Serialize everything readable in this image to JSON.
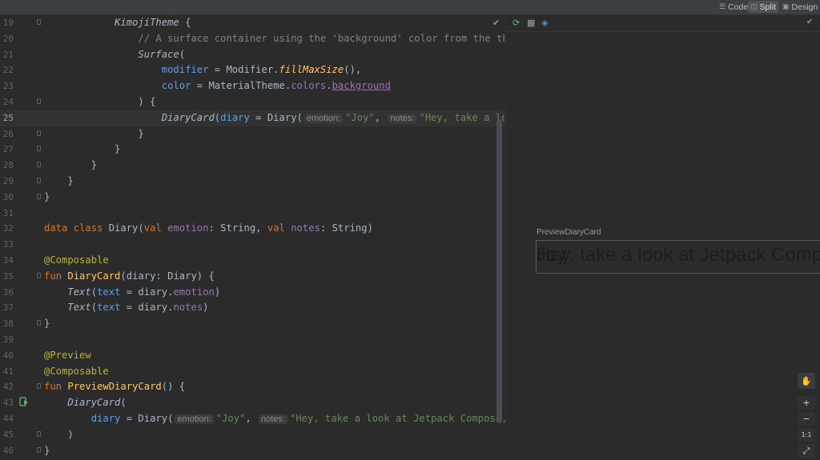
{
  "view_modes": {
    "code": "Code",
    "split": "Split",
    "design": "Design"
  },
  "editor": {
    "lines": [
      {
        "n": "19",
        "html": "            <span class=\"comp\">KimojiTheme</span> {"
      },
      {
        "n": "20",
        "html": "                <span class=\"cmt\">// A surface container using the 'background' color from the theme</span>"
      },
      {
        "n": "21",
        "html": "                <span class=\"comp\">Surface</span>("
      },
      {
        "n": "22",
        "html": "                    <span class=\"param\">modifier</span> = Modifier.<span class=\"fn it\">fillMaxSize</span>(),"
      },
      {
        "n": "23",
        "html": "                    <span class=\"param\">color</span> = MaterialTheme.<span class=\"prop\">colors</span>.<span class=\"prop ul\">background</span>"
      },
      {
        "n": "24",
        "html": "                ) {"
      },
      {
        "n": "25",
        "html": "                    <span class=\"comp\">DiaryCard</span>(<span class=\"param\">diary</span> = Diary(<span class=\"hint\">emotion:</span><span class=\"str\">\"Joy\"</span>, <span class=\"hint\">notes:</span><span class=\"str\">\"Hey, take a look at Jetpack Compose\"</span>))"
      },
      {
        "n": "26",
        "html": "                }"
      },
      {
        "n": "27",
        "html": "            }"
      },
      {
        "n": "28",
        "html": "        }"
      },
      {
        "n": "29",
        "html": "    }"
      },
      {
        "n": "30",
        "html": "}"
      },
      {
        "n": "31",
        "html": ""
      },
      {
        "n": "32",
        "html": "<span class=\"kw\">data class</span> Diary(<span class=\"kw\">val</span> <span class=\"prop\">emotion</span>: String, <span class=\"kw\">val</span> <span class=\"prop\">notes</span>: String)"
      },
      {
        "n": "33",
        "html": ""
      },
      {
        "n": "34",
        "html": "<span class=\"ann\">@Composable</span>"
      },
      {
        "n": "35",
        "html": "<span class=\"kw\">fun</span> <span class=\"fn\">DiaryCard</span>(diary: Diary) {"
      },
      {
        "n": "36",
        "html": "    <span class=\"comp\">Text</span>(<span class=\"param\">text</span> = diary.<span class=\"prop\">emotion</span>)"
      },
      {
        "n": "37",
        "html": "    <span class=\"comp\">Text</span>(<span class=\"param\">text</span> = diary.<span class=\"prop\">notes</span>)"
      },
      {
        "n": "38",
        "html": "}"
      },
      {
        "n": "39",
        "html": ""
      },
      {
        "n": "40",
        "html": "<span class=\"ann\">@Preview</span>"
      },
      {
        "n": "41",
        "html": "<span class=\"ann\">@Composable</span>"
      },
      {
        "n": "42",
        "html": "<span class=\"kw\">fun</span> <span class=\"fn\">PreviewDiaryCard</span>() {"
      },
      {
        "n": "43",
        "html": "    <span class=\"comp\">DiaryCard</span>("
      },
      {
        "n": "44",
        "html": "        <span class=\"param\">diary</span> = Diary(<span class=\"hint\">emotion:</span><span class=\"str\">\"Joy\"</span>, <span class=\"hint\">notes:</span><span class=\"str\">\"Hey, take a look at Jetpack Compose, it's great!\"</span>)"
      },
      {
        "n": "45",
        "html": "    )"
      },
      {
        "n": "46",
        "html": "}"
      }
    ],
    "current_line": "25",
    "fold_lines": [
      "19",
      "24",
      "26",
      "27",
      "28",
      "29",
      "30",
      "35",
      "38",
      "42",
      "45",
      "46"
    ]
  },
  "preview": {
    "label": "PreviewDiaryCard",
    "text_emotion": "Joy",
    "text_notes": "Hey, take a look at Jetpack Compose",
    "zoom_buttons": [
      "+",
      "−",
      "1:1",
      "⤢"
    ]
  },
  "colors": {
    "bg": "#2b2b2b",
    "keyword": "#cc7832",
    "function": "#ffc66d",
    "string": "#6a8759",
    "annotation": "#bbb529",
    "check": "#5fb760"
  }
}
